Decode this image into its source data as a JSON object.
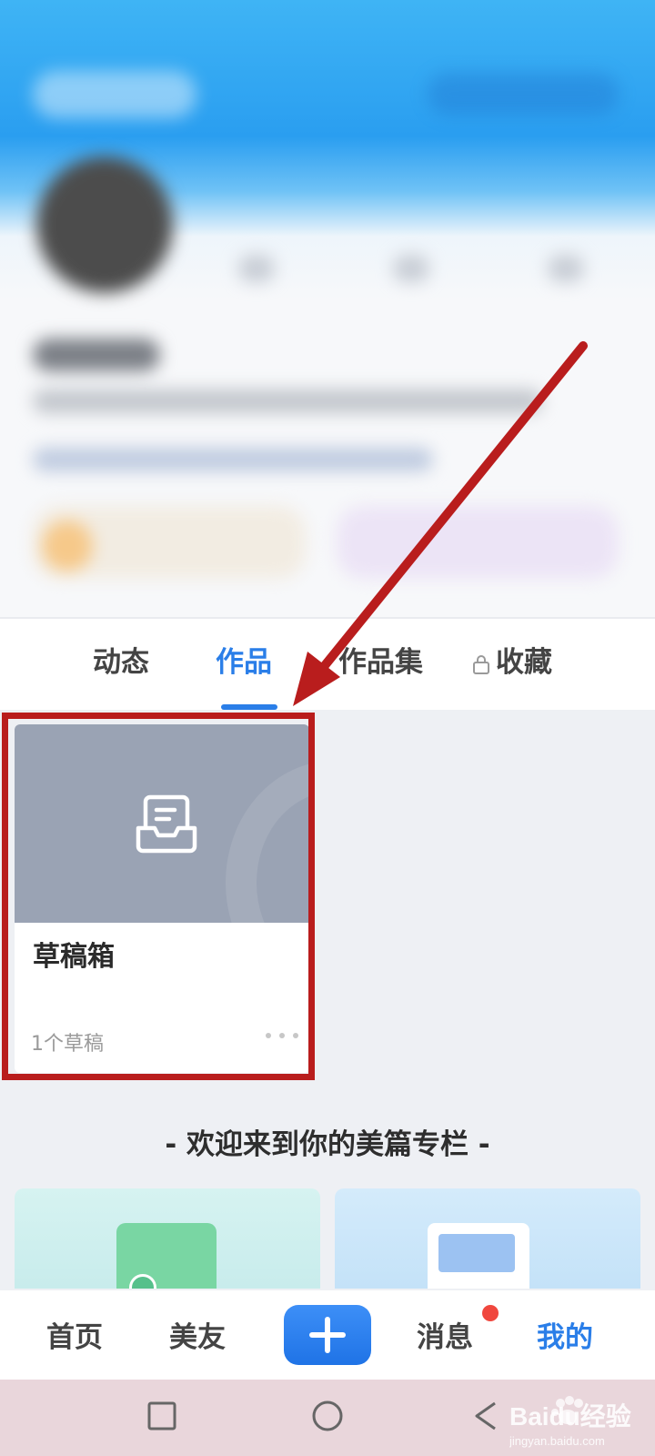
{
  "tabs": [
    {
      "label": "动态",
      "active": false
    },
    {
      "label": "作品",
      "active": true
    },
    {
      "label": "作品集",
      "active": false
    },
    {
      "label": "收藏",
      "active": false,
      "locked": true
    }
  ],
  "draft_card": {
    "title": "草稿箱",
    "count": "1个草稿",
    "icon": "drafts-inbox-icon"
  },
  "welcome_text": "- 欢迎来到你的美篇专栏 -",
  "bottom_nav": {
    "items": [
      "首页",
      "美友",
      "消息",
      "我的"
    ],
    "active": "我的",
    "plus_icon": "plus-icon",
    "notification_dot": true
  },
  "watermark": {
    "brand": "Baidu经验",
    "url": "jingyan.baidu.com"
  },
  "colors": {
    "accent": "#2a7ee8",
    "highlight": "#b91d1d",
    "arrow": "#b91d1d",
    "badge": "#f0473e"
  }
}
